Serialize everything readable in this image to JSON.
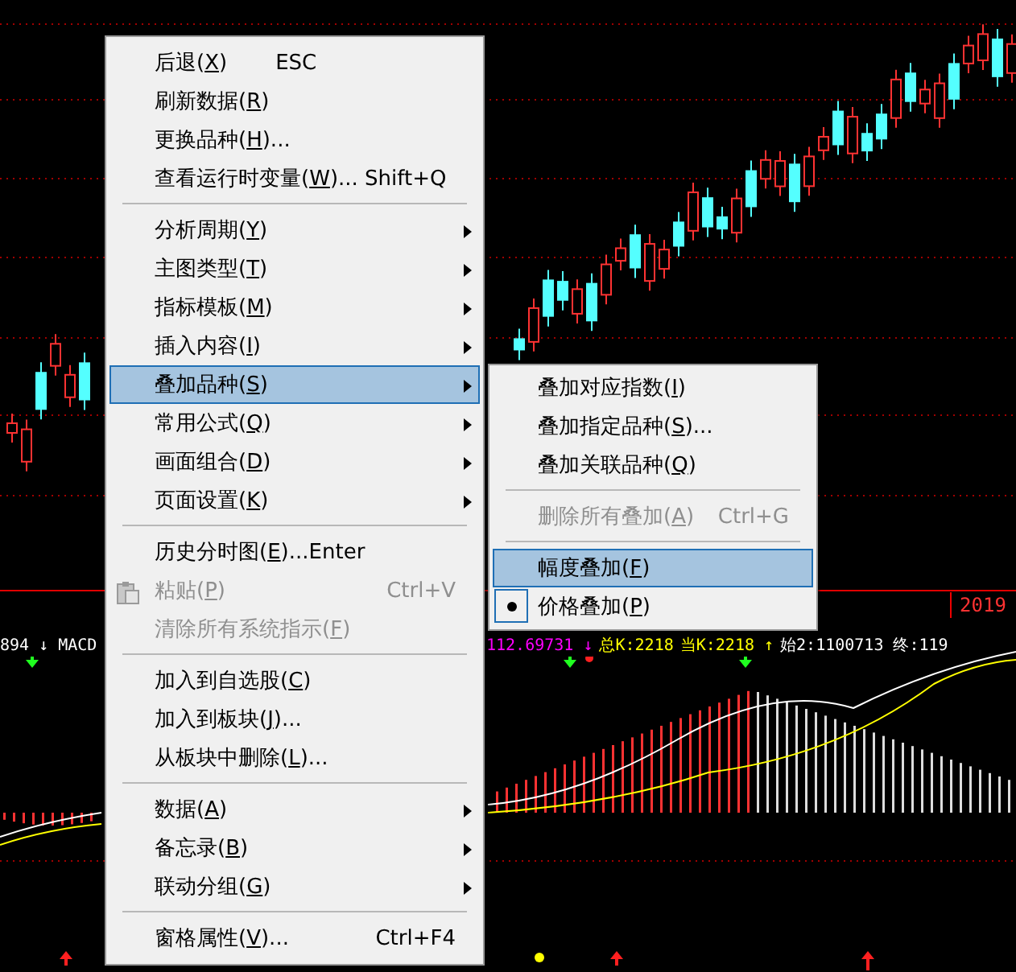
{
  "chart": {
    "year_label": "2019",
    "legend_left": "894 ↓ MACD",
    "legend_right": [
      {
        "text": "112.69731 ↓",
        "color": "#ff00ff"
      },
      {
        "text": "总K:2218",
        "color": "#ffff00"
      },
      {
        "text": "当K:2218 ↑",
        "color": "#ffff00"
      },
      {
        "text": "始2:1100713 终:119",
        "color": "#ffffff"
      }
    ]
  },
  "menu": {
    "items": [
      {
        "kind": "item",
        "label": "后退(X)",
        "hint": "ESC",
        "selected": false,
        "disabled": false,
        "has_submenu": false
      },
      {
        "kind": "item",
        "label": "刷新数据(R)",
        "selected": false,
        "disabled": false,
        "has_submenu": false
      },
      {
        "kind": "item",
        "label": "更换品种(H)...",
        "selected": false,
        "disabled": false,
        "has_submenu": false
      },
      {
        "kind": "item",
        "label": "查看运行时变量(W)... Shift+Q",
        "selected": false,
        "disabled": false,
        "has_submenu": false
      },
      {
        "kind": "separator"
      },
      {
        "kind": "item",
        "label": "分析周期(Y)",
        "selected": false,
        "disabled": false,
        "has_submenu": true
      },
      {
        "kind": "item",
        "label": "主图类型(T)",
        "selected": false,
        "disabled": false,
        "has_submenu": true
      },
      {
        "kind": "item",
        "label": "指标模板(M)",
        "selected": false,
        "disabled": false,
        "has_submenu": true
      },
      {
        "kind": "item",
        "label": "插入内容(I)",
        "selected": false,
        "disabled": false,
        "has_submenu": true
      },
      {
        "kind": "item",
        "label": "叠加品种(S)",
        "selected": true,
        "disabled": false,
        "has_submenu": true
      },
      {
        "kind": "item",
        "label": "常用公式(Q)",
        "selected": false,
        "disabled": false,
        "has_submenu": true
      },
      {
        "kind": "item",
        "label": "画面组合(D)",
        "selected": false,
        "disabled": false,
        "has_submenu": true
      },
      {
        "kind": "item",
        "label": "页面设置(K)",
        "selected": false,
        "disabled": false,
        "has_submenu": true
      },
      {
        "kind": "separator"
      },
      {
        "kind": "item",
        "label": "历史分时图(E)...Enter",
        "selected": false,
        "disabled": false,
        "has_submenu": false
      },
      {
        "kind": "icon_item",
        "label": "粘贴(P)",
        "shortcut": "Ctrl+V",
        "selected": false,
        "disabled": true,
        "has_submenu": false
      },
      {
        "kind": "item",
        "label": "清除所有系统指示(F)",
        "selected": false,
        "disabled": true,
        "has_submenu": false
      },
      {
        "kind": "separator"
      },
      {
        "kind": "item",
        "label": "加入到自选股(C)",
        "selected": false,
        "disabled": false,
        "has_submenu": false
      },
      {
        "kind": "item",
        "label": "加入到板块(J)...",
        "selected": false,
        "disabled": false,
        "has_submenu": false
      },
      {
        "kind": "item",
        "label": "从板块中删除(L)...",
        "selected": false,
        "disabled": false,
        "has_submenu": false
      },
      {
        "kind": "separator"
      },
      {
        "kind": "item",
        "label": "数据(A)",
        "selected": false,
        "disabled": false,
        "has_submenu": true
      },
      {
        "kind": "item",
        "label": "备忘录(B)",
        "selected": false,
        "disabled": false,
        "has_submenu": true
      },
      {
        "kind": "item",
        "label": "联动分组(G)",
        "selected": false,
        "disabled": false,
        "has_submenu": true
      },
      {
        "kind": "separator"
      },
      {
        "kind": "item",
        "label": "窗格属性(V)...",
        "shortcut": "Ctrl+F4",
        "selected": false,
        "disabled": false,
        "has_submenu": false
      }
    ]
  },
  "submenu": {
    "items": [
      {
        "kind": "item",
        "label": "叠加对应指数(I)",
        "selected": false,
        "disabled": false,
        "checked": false
      },
      {
        "kind": "item",
        "label": "叠加指定品种(S)...",
        "selected": false,
        "disabled": false,
        "checked": false
      },
      {
        "kind": "item",
        "label": "叠加关联品种(Q)",
        "selected": false,
        "disabled": false,
        "checked": false
      },
      {
        "kind": "separator"
      },
      {
        "kind": "item",
        "label": "删除所有叠加(A)",
        "shortcut": "Ctrl+G",
        "selected": false,
        "disabled": true,
        "checked": false
      },
      {
        "kind": "separator"
      },
      {
        "kind": "item",
        "label": "幅度叠加(F)",
        "selected": true,
        "disabled": false,
        "checked": false
      },
      {
        "kind": "item",
        "label": "价格叠加(P)",
        "selected": false,
        "disabled": false,
        "checked": true
      }
    ]
  }
}
